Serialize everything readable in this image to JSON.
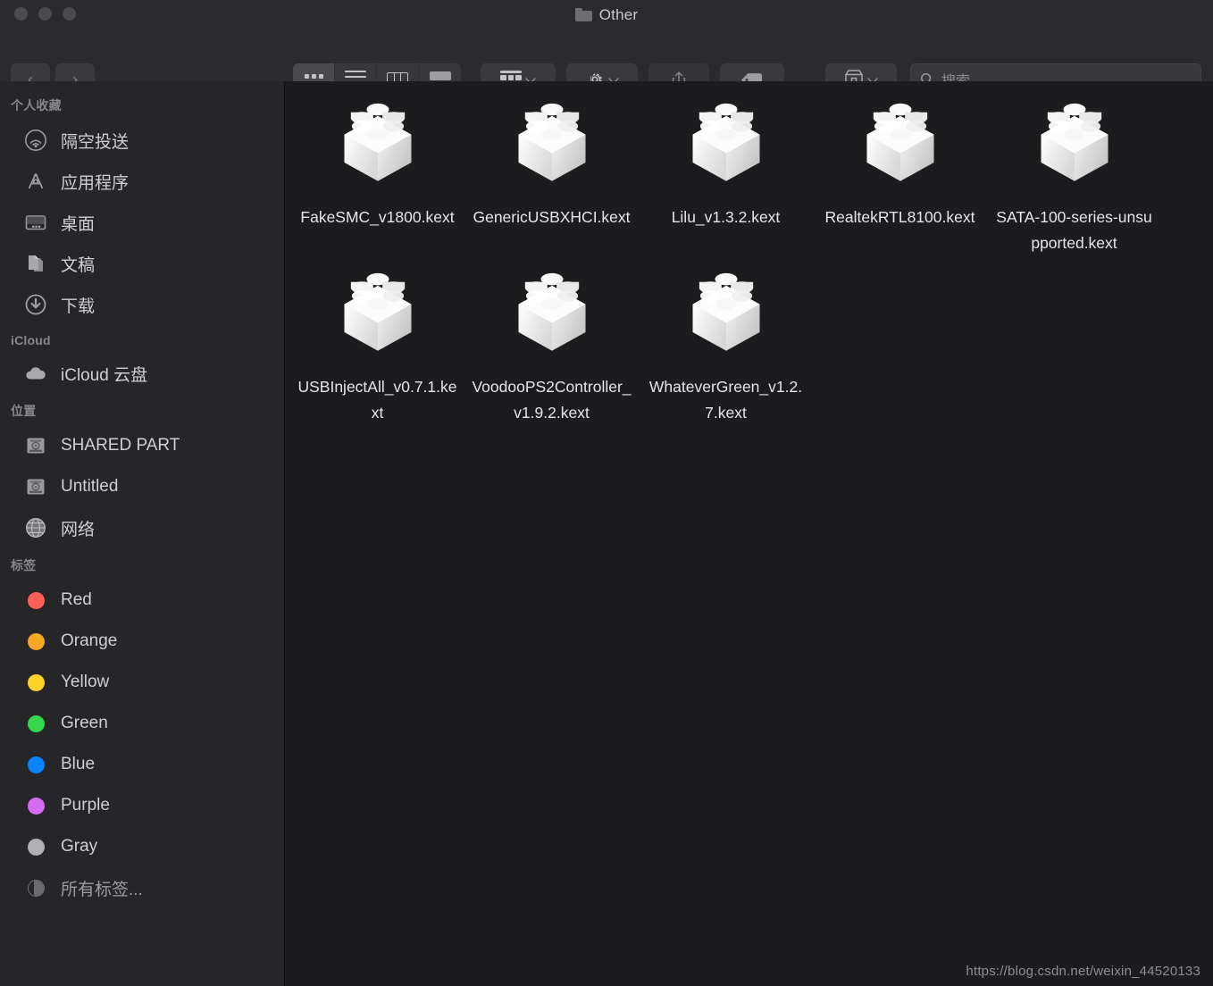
{
  "window": {
    "title": "Other",
    "title_icon": "folder-icon",
    "traffic_lights": [
      "close-button",
      "minimize-button",
      "zoom-button"
    ]
  },
  "toolbar": {
    "back_label": "‹",
    "forward_label": "›",
    "view_modes": [
      {
        "name": "icon-view",
        "icon": "grid-icon",
        "active": true
      },
      {
        "name": "list-view",
        "icon": "list-icon",
        "active": false
      },
      {
        "name": "column-view",
        "icon": "columns-icon",
        "active": false
      },
      {
        "name": "gallery-view",
        "icon": "gallery-icon",
        "active": false
      }
    ],
    "group_by": {
      "name": "group-by-button",
      "icon": "group-icon"
    },
    "action": {
      "name": "action-button",
      "icon": "gear-icon"
    },
    "share": {
      "name": "share-button",
      "icon": "share-icon"
    },
    "tags": {
      "name": "tag-button",
      "icon": "tag-icon"
    },
    "kext_utility": {
      "name": "kext-utility-button",
      "icon": "kext-box-icon"
    }
  },
  "search": {
    "placeholder": "搜索",
    "value": "",
    "icon": "search-icon"
  },
  "sidebar": {
    "sections": [
      {
        "header": "个人收藏",
        "items": [
          {
            "label": "隔空投送",
            "icon": "airdrop-icon"
          },
          {
            "label": "应用程序",
            "icon": "applications-icon"
          },
          {
            "label": "桌面",
            "icon": "desktop-icon"
          },
          {
            "label": "文稿",
            "icon": "documents-icon"
          },
          {
            "label": "下载",
            "icon": "downloads-icon"
          }
        ]
      },
      {
        "header": "iCloud",
        "items": [
          {
            "label": "iCloud 云盘",
            "icon": "cloud-icon"
          }
        ]
      },
      {
        "header": "位置",
        "items": [
          {
            "label": "SHARED PART",
            "icon": "harddisk-icon"
          },
          {
            "label": "Untitled",
            "icon": "harddisk-icon"
          },
          {
            "label": "网络",
            "icon": "network-globe-icon"
          }
        ]
      },
      {
        "header": "标签",
        "items": [
          {
            "label": "Red",
            "icon": "tag-dot-icon",
            "color": "#ff5f57"
          },
          {
            "label": "Orange",
            "icon": "tag-dot-icon",
            "color": "#f5a623"
          },
          {
            "label": "Yellow",
            "icon": "tag-dot-icon",
            "color": "#ffd426"
          },
          {
            "label": "Green",
            "icon": "tag-dot-icon",
            "color": "#32d74b"
          },
          {
            "label": "Blue",
            "icon": "tag-dot-icon",
            "color": "#0a84ff"
          },
          {
            "label": "Purple",
            "icon": "tag-dot-icon",
            "color": "#d76bf5"
          },
          {
            "label": "Gray",
            "icon": "tag-dot-icon",
            "color": "#b0b0b4"
          },
          {
            "label": "所有标签...",
            "icon": "all-tags-icon",
            "color": ""
          }
        ]
      }
    ]
  },
  "content": {
    "files": [
      {
        "name": "FakeSMC_v1800.kext",
        "icon": "kext-brick-icon"
      },
      {
        "name": "GenericUSBXHCI.kext",
        "icon": "kext-brick-icon"
      },
      {
        "name": "Lilu_v1.3.2.kext",
        "icon": "kext-brick-icon"
      },
      {
        "name": "RealtekRTL8100.kext",
        "icon": "kext-brick-icon"
      },
      {
        "name": "SATA-100-series-unsupported.kext",
        "icon": "kext-brick-icon"
      },
      {
        "name": "USBInjectAll_v0.7.1.kext",
        "icon": "kext-brick-icon"
      },
      {
        "name": "VoodooPS2Controller_v1.9.2.kext",
        "icon": "kext-brick-icon"
      },
      {
        "name": "WhateverGreen_v1.2.7.kext",
        "icon": "kext-brick-icon"
      }
    ],
    "watermark": "https://blog.csdn.net/weixin_44520133"
  },
  "colors": {
    "titlebar": "#2b2b2d",
    "sidebar": "#262628",
    "content": "#1c1c1e",
    "text": "#cfcfd2"
  }
}
